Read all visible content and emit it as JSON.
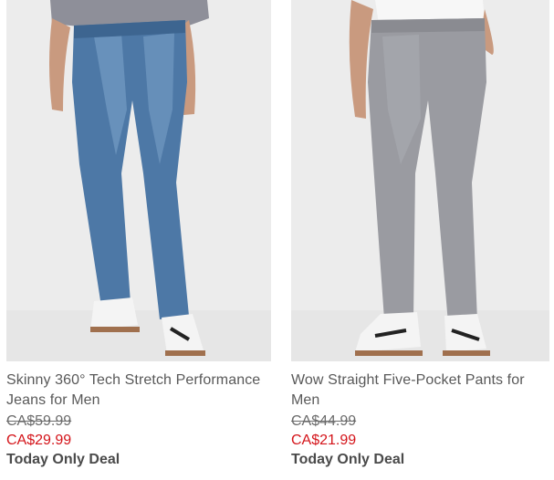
{
  "products": [
    {
      "title": "Skinny 360° Tech Stretch Performance Jeans for Men",
      "original_price": "CA$59.99",
      "sale_price": "CA$29.99",
      "promo": "Today Only Deal",
      "image": "blue-denim-jeans"
    },
    {
      "title": "Wow Straight Five-Pocket Pants for Men",
      "original_price": "CA$44.99",
      "sale_price": "CA$21.99",
      "promo": "Today Only Deal",
      "image": "grey-five-pocket-pants"
    }
  ],
  "colors": {
    "sale_price": "#d4141a",
    "text": "#595959",
    "image_background": "#ececec"
  }
}
